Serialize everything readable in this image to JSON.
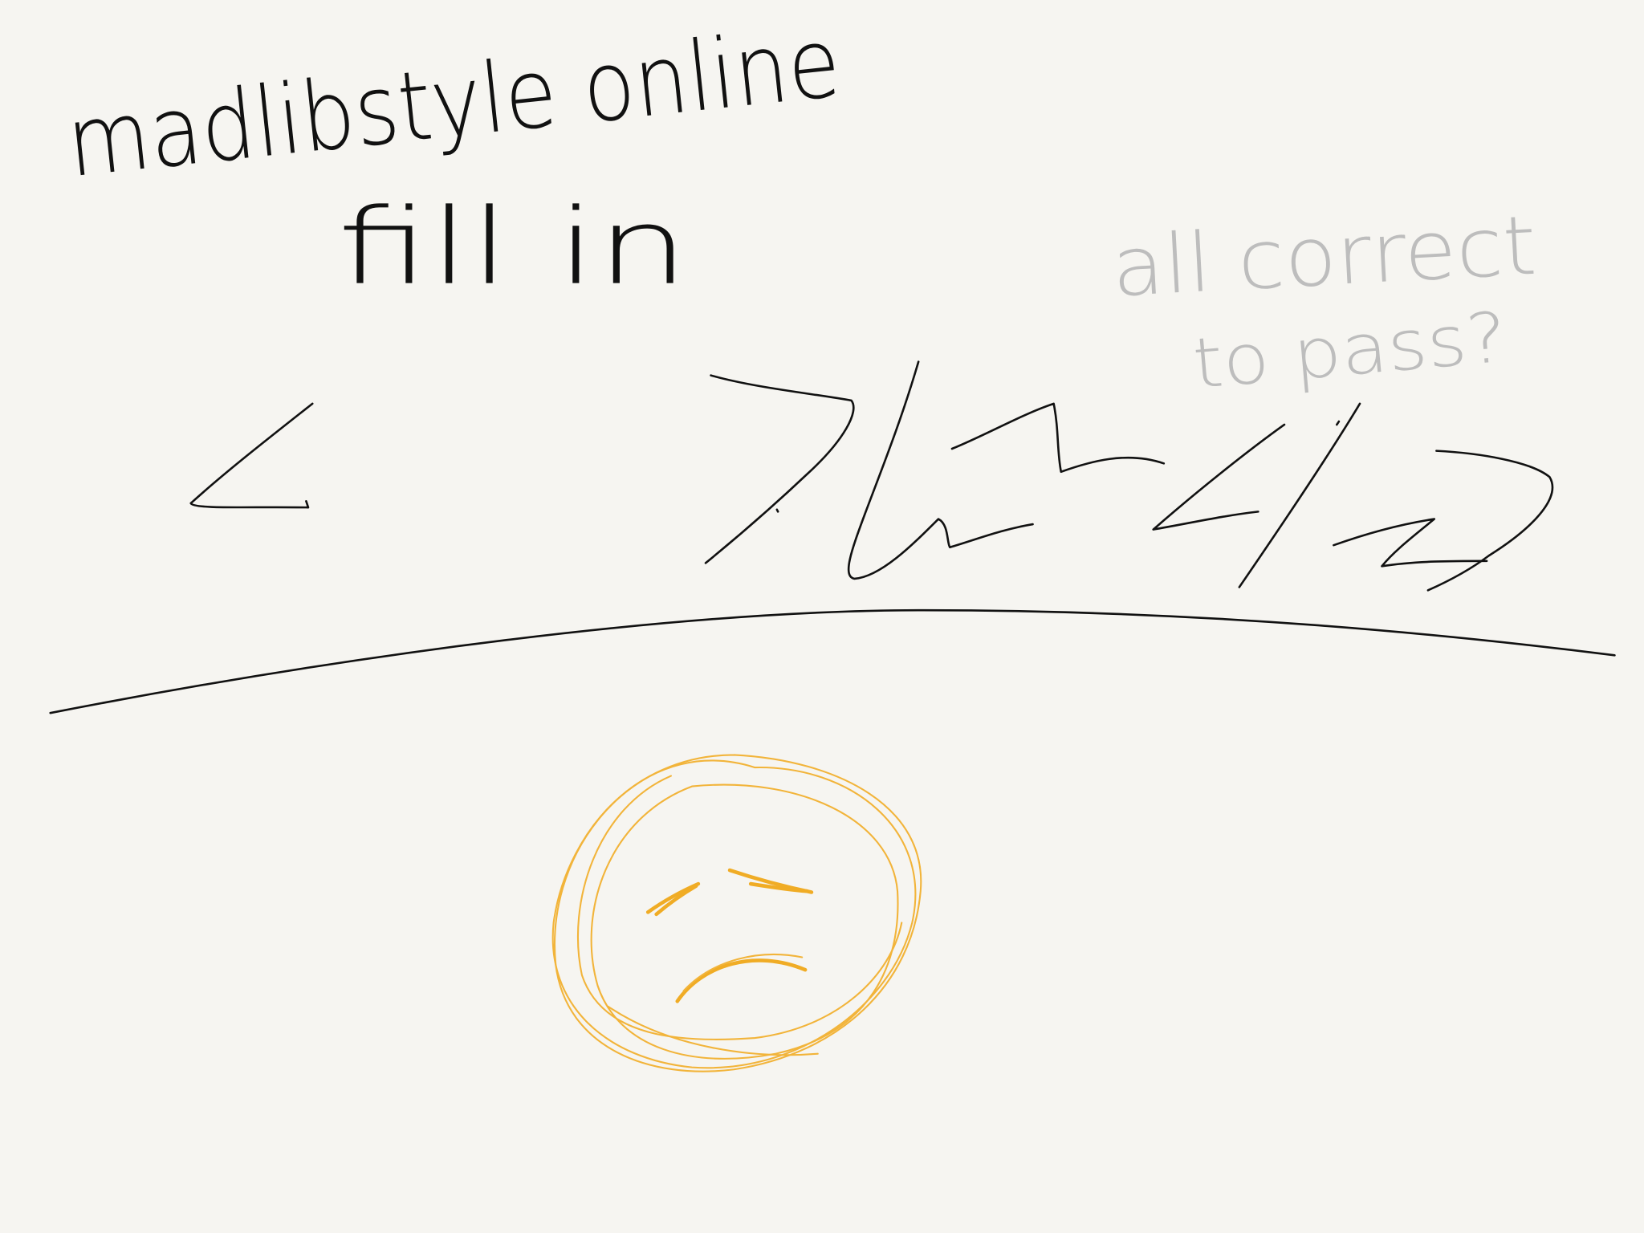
{
  "canvas": {
    "background_color": "#f6f5f1",
    "ink_color": "#111111",
    "pencil_color": "#b9b9b9",
    "marker_color": "#f2b43a"
  },
  "notes": {
    "title_line1": "madlibstyle online",
    "title_line2": "fill in",
    "side_note_line1": "all correct",
    "side_note_line2": "to pass?"
  },
  "drawings": {
    "less_than_icon": "less-than-sign",
    "scribble_icon": "scribbled-answer",
    "divider": "curved-divider-line",
    "face_icon": "sad-face"
  }
}
